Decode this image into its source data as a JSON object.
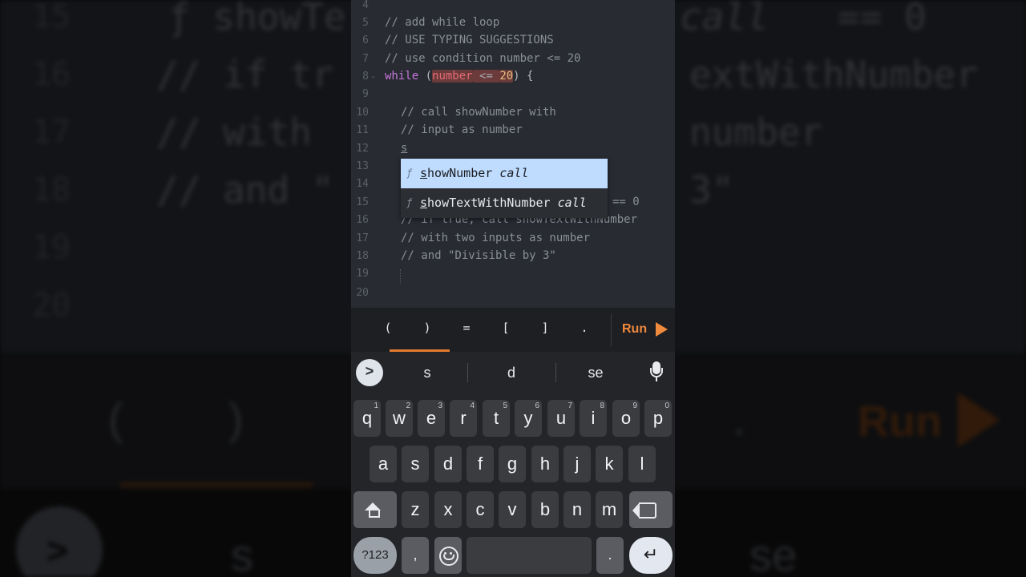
{
  "background_echo": {
    "line_numbers": [
      "15",
      "16",
      "17",
      "18",
      "19",
      "20"
    ],
    "lines": [
      "ƒ  showTe",
      "call",
      "== 0",
      "// if tr",
      "extWithNumber",
      "// with",
      "number",
      "// and \"",
      "3\""
    ],
    "toolbar_keys": [
      "(",
      ")",
      "."
    ],
    "run_label": "Run",
    "suggestions": [
      "s",
      "se"
    ]
  },
  "editor": {
    "lines": [
      {
        "num": "4",
        "text": ""
      },
      {
        "num": "5",
        "text": "// add while loop"
      },
      {
        "num": "6",
        "text": "// USE TYPING SUGGESTIONS"
      },
      {
        "num": "7",
        "text": "// use condition number <= 20"
      },
      {
        "num": "8",
        "kw": "while",
        "open": " (",
        "var": "number",
        "op": " <= ",
        "lit": "20",
        "close": ") {"
      },
      {
        "num": "9",
        "text": ""
      },
      {
        "num": "10",
        "text": "// call showNumber with"
      },
      {
        "num": "11",
        "text": "// input as number"
      },
      {
        "num": "12",
        "text": "s"
      },
      {
        "num": "13",
        "text": ""
      },
      {
        "num": "14",
        "text": ""
      },
      {
        "num": "15",
        "text": "== 0"
      },
      {
        "num": "16",
        "text": "// if true, call showTextWithNumber"
      },
      {
        "num": "17",
        "text": "// with two inputs as number"
      },
      {
        "num": "18",
        "text": "// and \"Divisible by 3\""
      },
      {
        "num": "19",
        "text": ""
      },
      {
        "num": "20",
        "text": ""
      }
    ]
  },
  "autocomplete": {
    "items": [
      {
        "icon": "ƒ",
        "first": "s",
        "rest": "howNumber ",
        "type": "call"
      },
      {
        "icon": "ƒ",
        "first": "s",
        "rest": "howTextWithNumber ",
        "type": "call"
      }
    ]
  },
  "toolbar": {
    "keys": [
      "(",
      ")",
      "=",
      "[",
      "]",
      "."
    ],
    "run_label": "Run"
  },
  "keyboard": {
    "chevron": ">",
    "suggestions": [
      "s",
      "d",
      "se"
    ],
    "row1": [
      {
        "k": "q",
        "s": "1"
      },
      {
        "k": "w",
        "s": "2"
      },
      {
        "k": "e",
        "s": "3"
      },
      {
        "k": "r",
        "s": "4"
      },
      {
        "k": "t",
        "s": "5"
      },
      {
        "k": "y",
        "s": "6"
      },
      {
        "k": "u",
        "s": "7"
      },
      {
        "k": "i",
        "s": "8"
      },
      {
        "k": "o",
        "s": "9"
      },
      {
        "k": "p",
        "s": "0"
      }
    ],
    "row2": [
      "a",
      "s",
      "d",
      "f",
      "g",
      "h",
      "j",
      "k",
      "l"
    ],
    "row3": [
      "z",
      "x",
      "c",
      "v",
      "b",
      "n",
      "m"
    ],
    "symbols_label": "?123",
    "comma": ",",
    "period": ".",
    "enter": "↵"
  }
}
